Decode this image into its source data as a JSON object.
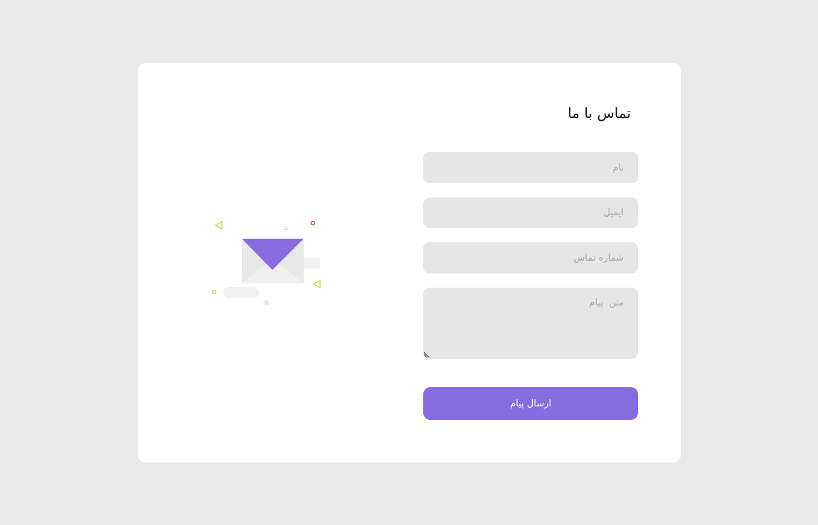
{
  "form": {
    "title": "تماس با ما",
    "name_placeholder": "نام",
    "email_placeholder": "ایمیل",
    "phone_placeholder": "شماره تماس",
    "message_placeholder": "متن  پیام",
    "submit_label": "ارسال پیام"
  },
  "colors": {
    "accent": "#866cdf",
    "background": "#e9e9e9",
    "input_bg": "#e6e6e6"
  },
  "icons": {
    "illustration": "envelope-illustration",
    "resize": "resize-grip-icon"
  }
}
